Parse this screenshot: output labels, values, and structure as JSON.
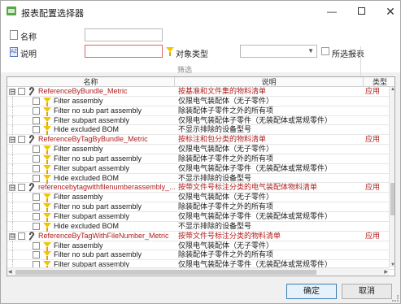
{
  "window": {
    "title": "报表配置选择器"
  },
  "filters": {
    "name_label": "名称",
    "name_value": "",
    "desc_label": "说明",
    "desc_value": "",
    "object_type_label": "对象类型",
    "object_type_value": "",
    "selected_reports_label": "所选报表",
    "selected_reports_checked": false,
    "group_caption": "筛选"
  },
  "grid": {
    "columns": [
      "名称",
      "说明",
      "类型"
    ],
    "rows": [
      {
        "kind": "parent",
        "expander": "⊟",
        "name": "ReferenceByBundle_Metric",
        "desc": "按基准和文件集的物料清单",
        "type": "应用"
      },
      {
        "kind": "child",
        "name": "Filter assembly",
        "desc": "仅限电气装配体（无子零件）",
        "type": ""
      },
      {
        "kind": "child",
        "name": "Filter no sub part assembly",
        "desc": "除装配体子零件之外的所有项",
        "type": ""
      },
      {
        "kind": "child",
        "name": "Filter subpart assembly",
        "desc": "仅限电气装配体子零件（无装配体或常规零件）",
        "type": ""
      },
      {
        "kind": "child",
        "name": "Hide excluded BOM",
        "desc": "不显示排除的设备型号",
        "type": ""
      },
      {
        "kind": "parent",
        "expander": "⊟",
        "name": "ReferenceByTagByBundle_Metric",
        "desc": "按标注和包分类的物料清单",
        "type": "应用"
      },
      {
        "kind": "child",
        "name": "Filter assembly",
        "desc": "仅限电气装配体（无子零件）",
        "type": ""
      },
      {
        "kind": "child",
        "name": "Filter no sub part assembly",
        "desc": "除装配体子零件之外的所有项",
        "type": ""
      },
      {
        "kind": "child",
        "name": "Filter subpart assembly",
        "desc": "仅限电气装配体子零件（无装配体或常规零件）",
        "type": ""
      },
      {
        "kind": "child",
        "name": "Hide excluded BOM",
        "desc": "不显示排除的设备型号",
        "type": ""
      },
      {
        "kind": "parent",
        "expander": "⊟",
        "name": "referencebytagwithfilenumberassembly_...",
        "desc": "按带文件号标注分类的电气装配体物料清单",
        "type": "应用"
      },
      {
        "kind": "child",
        "name": "Filter assembly",
        "desc": "仅限电气装配体（无子零件）",
        "type": ""
      },
      {
        "kind": "child",
        "name": "Filter no sub part assembly",
        "desc": "除装配体子零件之外的所有项",
        "type": ""
      },
      {
        "kind": "child",
        "name": "Filter subpart assembly",
        "desc": "仅限电气装配体子零件（无装配体或常规零件）",
        "type": ""
      },
      {
        "kind": "child",
        "name": "Hide excluded BOM",
        "desc": "不显示排除的设备型号",
        "type": ""
      },
      {
        "kind": "parent",
        "expander": "⊟",
        "name": "ReferenceByTagWithFileNumber_Metric",
        "desc": "按带文件号标注分类的物料清单",
        "type": "应用"
      },
      {
        "kind": "child",
        "name": "Filter assembly",
        "desc": "仅限电气装配体（无子零件）",
        "type": ""
      },
      {
        "kind": "child",
        "name": "Filter no sub part assembly",
        "desc": "除装配体子零件之外的所有项",
        "type": ""
      },
      {
        "kind": "child",
        "name": "Filter subpart assembly",
        "desc": "仅限电气装配体子零件（无装配体或常规零件）",
        "type": ""
      }
    ]
  },
  "buttons": {
    "ok": "确定",
    "cancel": "取消"
  },
  "icons": {
    "app": "report-config-icon",
    "name_field": "document-icon",
    "desc_field": "az-sort-icon",
    "object_type": "funnel-icon",
    "parent_row": "wrench-icon",
    "child_row": "funnel-icon"
  },
  "colors": {
    "parent_text": "#b01e1e",
    "funnel": "#f3c400",
    "ok_border": "#3c7fb1"
  }
}
